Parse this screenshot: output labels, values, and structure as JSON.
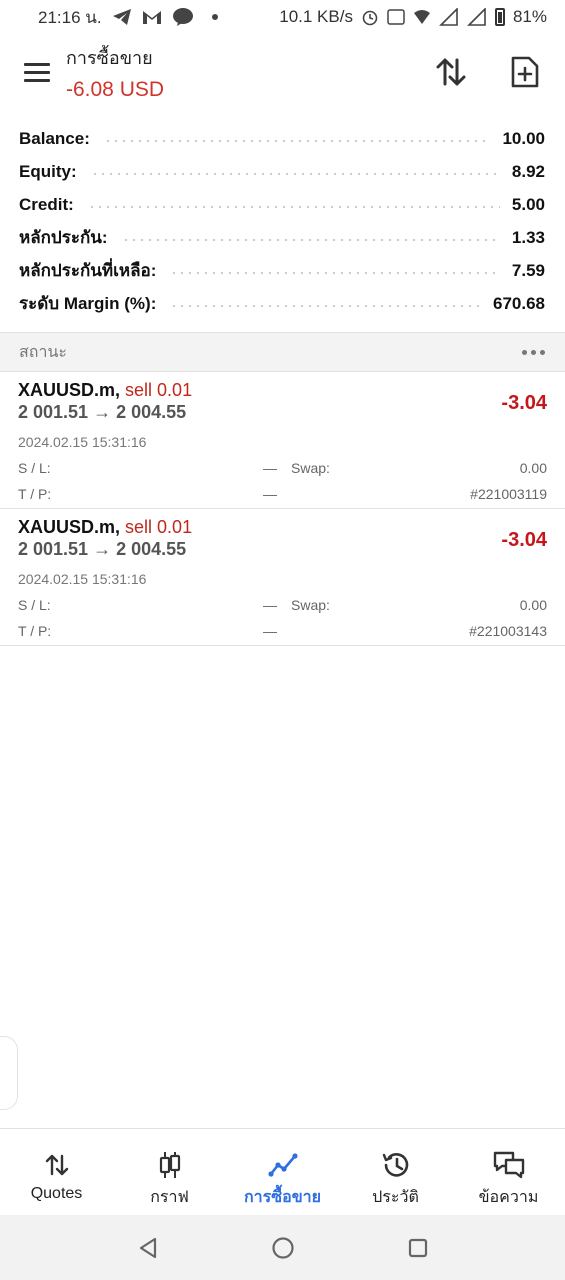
{
  "status_bar": {
    "time": "21:16 น.",
    "network_speed": "10.1 KB/s",
    "battery": "81%"
  },
  "header": {
    "title": "การซื้อขาย",
    "balance_change": "-6.08 USD"
  },
  "summary": [
    {
      "label": "Balance:",
      "value": "10.00"
    },
    {
      "label": "Equity:",
      "value": "8.92"
    },
    {
      "label": "Credit:",
      "value": "5.00"
    },
    {
      "label": "หลักประกัน:",
      "value": "1.33"
    },
    {
      "label": "หลักประกันที่เหลือ:",
      "value": "7.59"
    },
    {
      "label": "ระดับ Margin (%):",
      "value": "670.68"
    }
  ],
  "section": {
    "title": "สถานะ"
  },
  "positions": [
    {
      "symbol": "XAUUSD.m,",
      "side": "sell 0.01",
      "prices": "2 001.51 → 2 004.55",
      "profit": "-3.04",
      "time": "2024.02.15 15:31:16",
      "sl_label": "S / L:",
      "sl_value": "—",
      "tp_label": "T / P:",
      "tp_value": "—",
      "swap_label": "Swap:",
      "swap_value": "0.00",
      "ticket": "#221003119"
    },
    {
      "symbol": "XAUUSD.m,",
      "side": "sell 0.01",
      "prices": "2 001.51 → 2 004.55",
      "profit": "-3.04",
      "time": "2024.02.15 15:31:16",
      "sl_label": "S / L:",
      "sl_value": "—",
      "tp_label": "T / P:",
      "tp_value": "—",
      "swap_label": "Swap:",
      "swap_value": "0.00",
      "ticket": "#221003143"
    }
  ],
  "bottom_nav": [
    {
      "label": "Quotes",
      "icon": "quotes-arrows-icon",
      "active": false
    },
    {
      "label": "กราฟ",
      "icon": "candlestick-chart-icon",
      "active": false
    },
    {
      "label": "การซื้อขาย",
      "icon": "trade-line-icon",
      "active": true
    },
    {
      "label": "ประวัติ",
      "icon": "history-clock-icon",
      "active": false
    },
    {
      "label": "ข้อความ",
      "icon": "messages-icon",
      "active": false
    }
  ],
  "colors": {
    "loss_red": "#c4161c",
    "sell_red": "#c0281e",
    "header_red": "#d0352b",
    "active_blue": "#2f6fe0"
  }
}
